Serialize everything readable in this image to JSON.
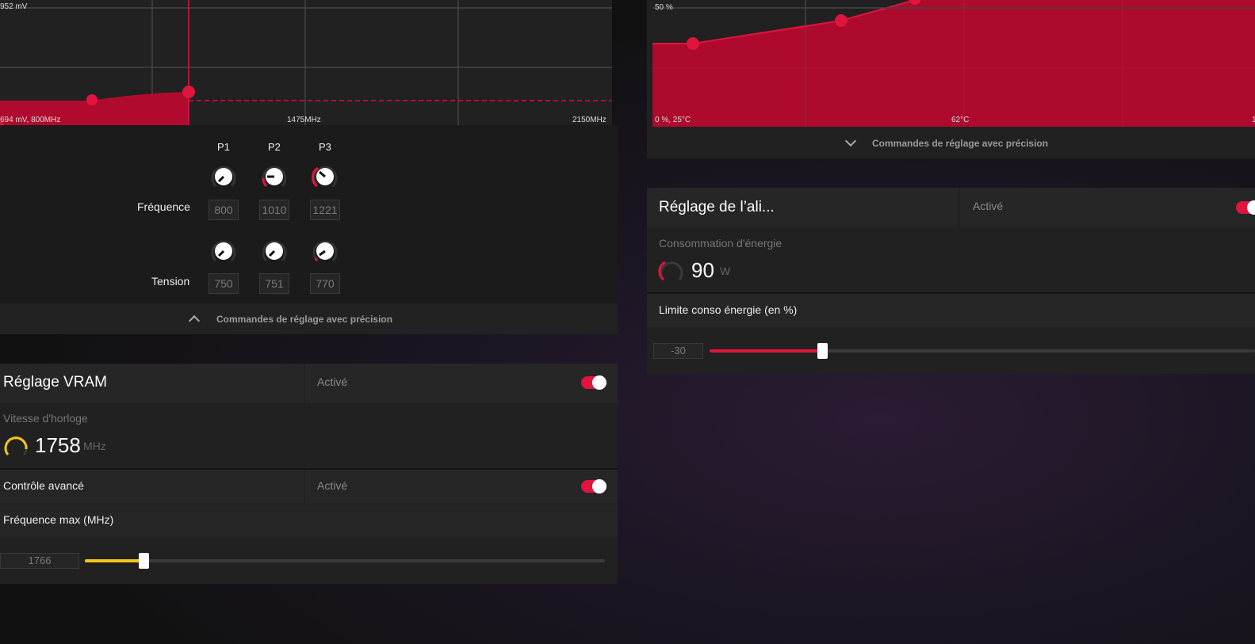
{
  "voltage_chart": {
    "y_top_label": "952 mV",
    "origin_label": "694 mV, 800MHz",
    "x_mid_label": "1475MHz",
    "x_max_label": "2150MHz",
    "accent": "#e0143c"
  },
  "fan_chart": {
    "y_mid_label": "50 %",
    "origin_label": "0 %, 25°C",
    "x_mid_label": "62°C",
    "x_max_label": "1"
  },
  "fine_tuning": {
    "columns": [
      "P1",
      "P2",
      "P3"
    ],
    "frequency_label": "Fréquence",
    "frequency_values": [
      "800",
      "1010",
      "1221"
    ],
    "voltage_label": "Tension",
    "voltage_values": [
      "750",
      "751",
      "770"
    ],
    "footer_label": "Commandes de réglage avec précision",
    "footer_icon": "chevron-up-icon"
  },
  "fan_footer": {
    "label": "Commandes de réglage avec précision",
    "icon": "chevron-down-icon"
  },
  "vram": {
    "title": "Réglage VRAM",
    "status": "Activé",
    "enabled": true,
    "clock_label": "Vitesse d'horloge",
    "clock_value": "1758",
    "clock_unit": "MHz",
    "gauge_color": "#f5c518",
    "advanced_label": "Contrôle avancé",
    "advanced_status": "Activé",
    "advanced_enabled": true,
    "max_freq_label": "Fréquence max (MHz)",
    "max_freq_value": "1766",
    "slider_fraction": 0.11
  },
  "power": {
    "title": "Réglage de l’ali...",
    "status": "Activé",
    "enabled": true,
    "consumption_label": "Consommation d'énergie",
    "consumption_value": "90",
    "consumption_unit": "W",
    "limit_label": "Limite conso énergie (en %)",
    "limit_value": "-30",
    "slider_fraction": 0.2
  }
}
